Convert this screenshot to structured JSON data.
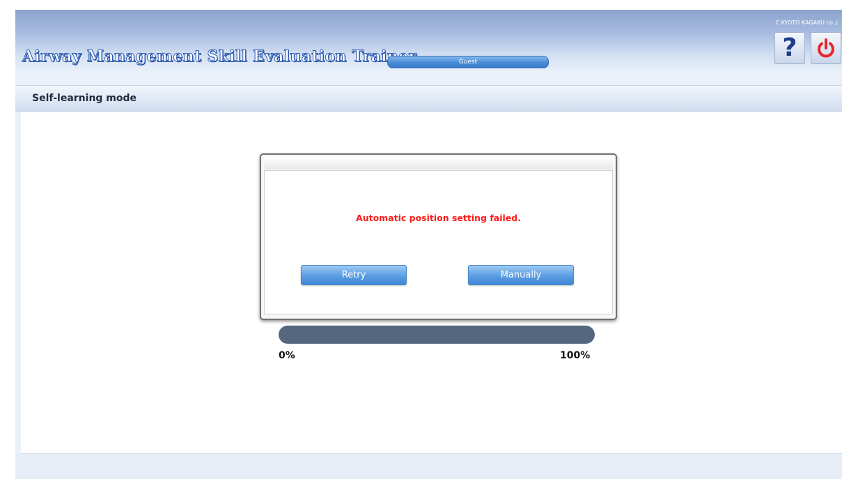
{
  "header": {
    "app_title": "Airway Management Skill Evaluation Trainer",
    "user_label": "Guest",
    "copyright": "C KYOTO KAGAKU co.,l"
  },
  "icons": {
    "help": "question-mark-icon",
    "power": "power-icon",
    "help_color": "#1e3c8a",
    "power_color": "#e8252b"
  },
  "mode": {
    "title": "Self-learning mode"
  },
  "dialog": {
    "message": "Automatic position setting failed.",
    "message_color": "#ff1a1a",
    "retry_label": "Retry",
    "manual_label": "Manually"
  },
  "progress": {
    "value_fraction": 0,
    "min_label": "0%",
    "max_label": "100%"
  }
}
